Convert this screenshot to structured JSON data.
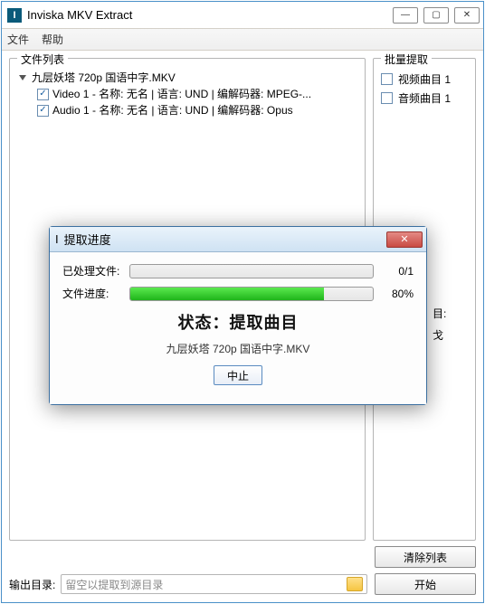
{
  "window": {
    "title": "Inviska MKV Extract",
    "icon_letter": "I"
  },
  "menu": {
    "file": "文件",
    "help": "帮助"
  },
  "panels": {
    "file_list_title": "文件列表",
    "batch_title": "批量提取"
  },
  "tree": {
    "root": "九层妖塔 720p 国语中字.MKV",
    "tracks": [
      {
        "checked": true,
        "label": "Video 1 - 名称: 无名 | 语言: UND | 编解码器: MPEG-..."
      },
      {
        "checked": true,
        "label": "Audio 1 - 名称: 无名 | 语言: UND | 编解码器: Opus"
      }
    ]
  },
  "batch_items": [
    {
      "checked": false,
      "label": "视频曲目 1"
    },
    {
      "checked": false,
      "label": "音频曲目 1"
    }
  ],
  "obscured_hints": {
    "a": "目:",
    "b": "戈"
  },
  "output": {
    "label": "输出目录:",
    "placeholder": "留空以提取到源目录"
  },
  "buttons": {
    "clear_list": "清除列表",
    "start": "开始"
  },
  "dialog": {
    "title": "提取进度",
    "processed_label": "已处理文件:",
    "processed_value": "0/1",
    "processed_pct": 0,
    "file_label": "文件进度:",
    "file_value": "80%",
    "file_pct": 80,
    "status_prefix": "状态：",
    "status_text": "提取曲目",
    "current_file": "九层妖塔 720p 国语中字.MKV",
    "abort": "中止"
  }
}
